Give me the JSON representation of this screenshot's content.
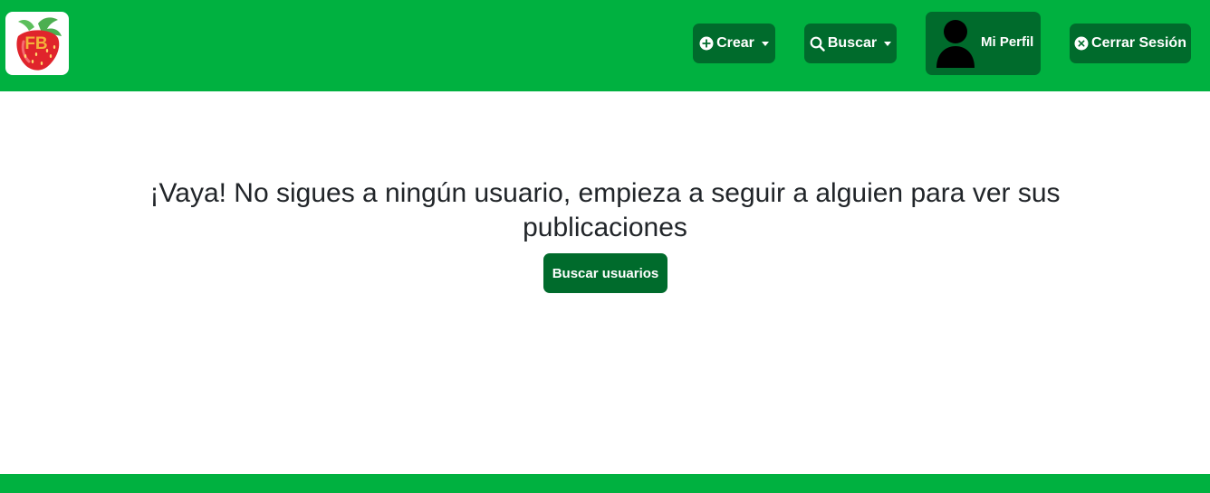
{
  "brand": {
    "logo_text": "FB",
    "logo_icon": "strawberry-logo"
  },
  "nav": {
    "crear_label": "Crear",
    "crear_icon": "plus-circle-icon",
    "buscar_label": "Buscar",
    "buscar_icon": "search-icon",
    "perfil_label": "Mi Perfil",
    "perfil_icon": "user-avatar-icon",
    "cerrar_label": "Cerrar Sesión",
    "cerrar_icon": "x-circle-icon"
  },
  "main": {
    "empty_message": "¡Vaya! No sigues a ningún usuario, empieza a seguir a alguien para ver sus publicaciones",
    "search_users_label": "Buscar usuarios"
  },
  "colors": {
    "primary": "#00b140",
    "button": "#006b2c",
    "text": "#212529",
    "logo_text": "#f4b13a",
    "strawberry": "#e0242c"
  }
}
